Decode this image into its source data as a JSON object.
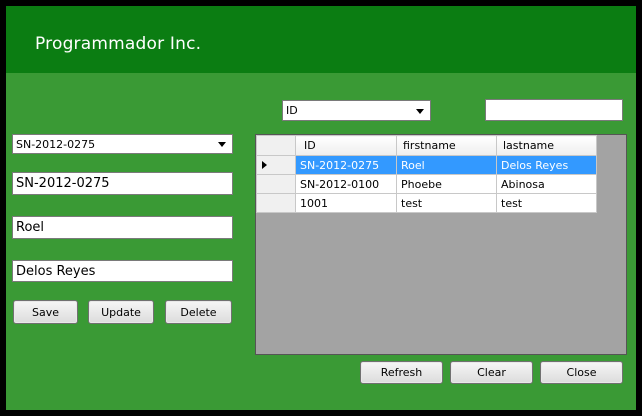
{
  "header": {
    "title": "Programmador Inc."
  },
  "search": {
    "field_selected": "ID",
    "query_value": ""
  },
  "form": {
    "record_select": "SN-2012-0275",
    "id_value": "SN-2012-0275",
    "firstname_value": "Roel",
    "lastname_value": "Delos Reyes"
  },
  "form_buttons": {
    "save": "Save",
    "update": "Update",
    "delete": "Delete"
  },
  "grid": {
    "columns": [
      "ID",
      "firstname",
      "lastname"
    ],
    "rows": [
      [
        "SN-2012-0275",
        "Roel",
        "Delos Reyes"
      ],
      [
        "SN-2012-0100",
        "Phoebe",
        "Abinosa"
      ],
      [
        "1001",
        "test",
        "test"
      ]
    ]
  },
  "bottom_buttons": {
    "refresh": "Refresh",
    "clear": "Clear",
    "close": "Close"
  },
  "colors": {
    "header": "#0b7d12",
    "body": "#3a9a35",
    "selection": "#3399ff",
    "grid_background": "#a3a3a3"
  }
}
